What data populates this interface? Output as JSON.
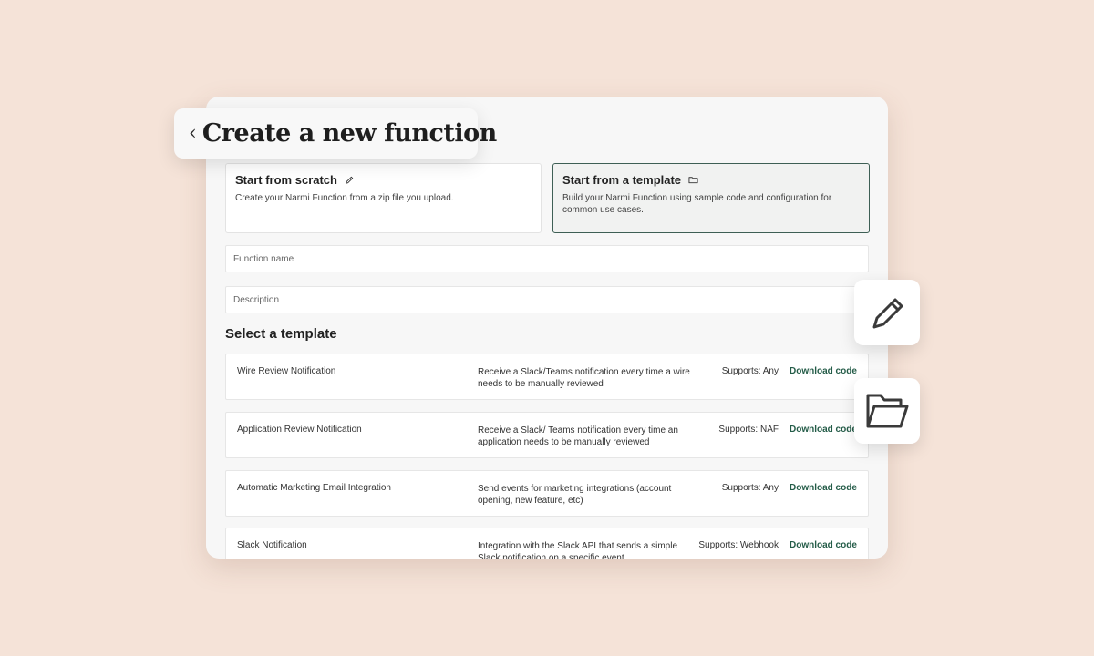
{
  "header": {
    "back_glyph": "‹",
    "title": "Create a new function"
  },
  "options": [
    {
      "title": "Start from scratch",
      "description": "Create your Narmi Function from a zip file you upload.",
      "icon": "pencil-icon",
      "selected": false
    },
    {
      "title": "Start from a template",
      "description": "Build your Narmi Function using sample code and configuration for common use cases.",
      "icon": "folder-icon",
      "selected": true
    }
  ],
  "form": {
    "function_name_placeholder": "Function name",
    "description_placeholder": "Description"
  },
  "templates": {
    "section_title": "Select a template",
    "rows": [
      {
        "name": "Wire Review Notification",
        "description": "Receive a Slack/Teams notification every time a wire needs to be manually reviewed",
        "supports": "Supports: Any",
        "action": "Download code"
      },
      {
        "name": "Application Review Notification",
        "description": "Receive a Slack/ Teams notification every time an application needs to be manually reviewed",
        "supports": "Supports: NAF",
        "action": "Download code"
      },
      {
        "name": "Automatic Marketing Email Integration",
        "description": "Send events for marketing integrations (account opening, new feature, etc)",
        "supports": "Supports: Any",
        "action": "Download code"
      },
      {
        "name": "Slack Notification",
        "description": "Integration with the Slack API that sends a simple Slack notification on a specific event",
        "supports": "Supports: Webhook",
        "action": "Download code"
      }
    ]
  },
  "colors": {
    "background": "#f5e3d8",
    "accent": "#245c48",
    "selected_border": "#3e5f55"
  }
}
